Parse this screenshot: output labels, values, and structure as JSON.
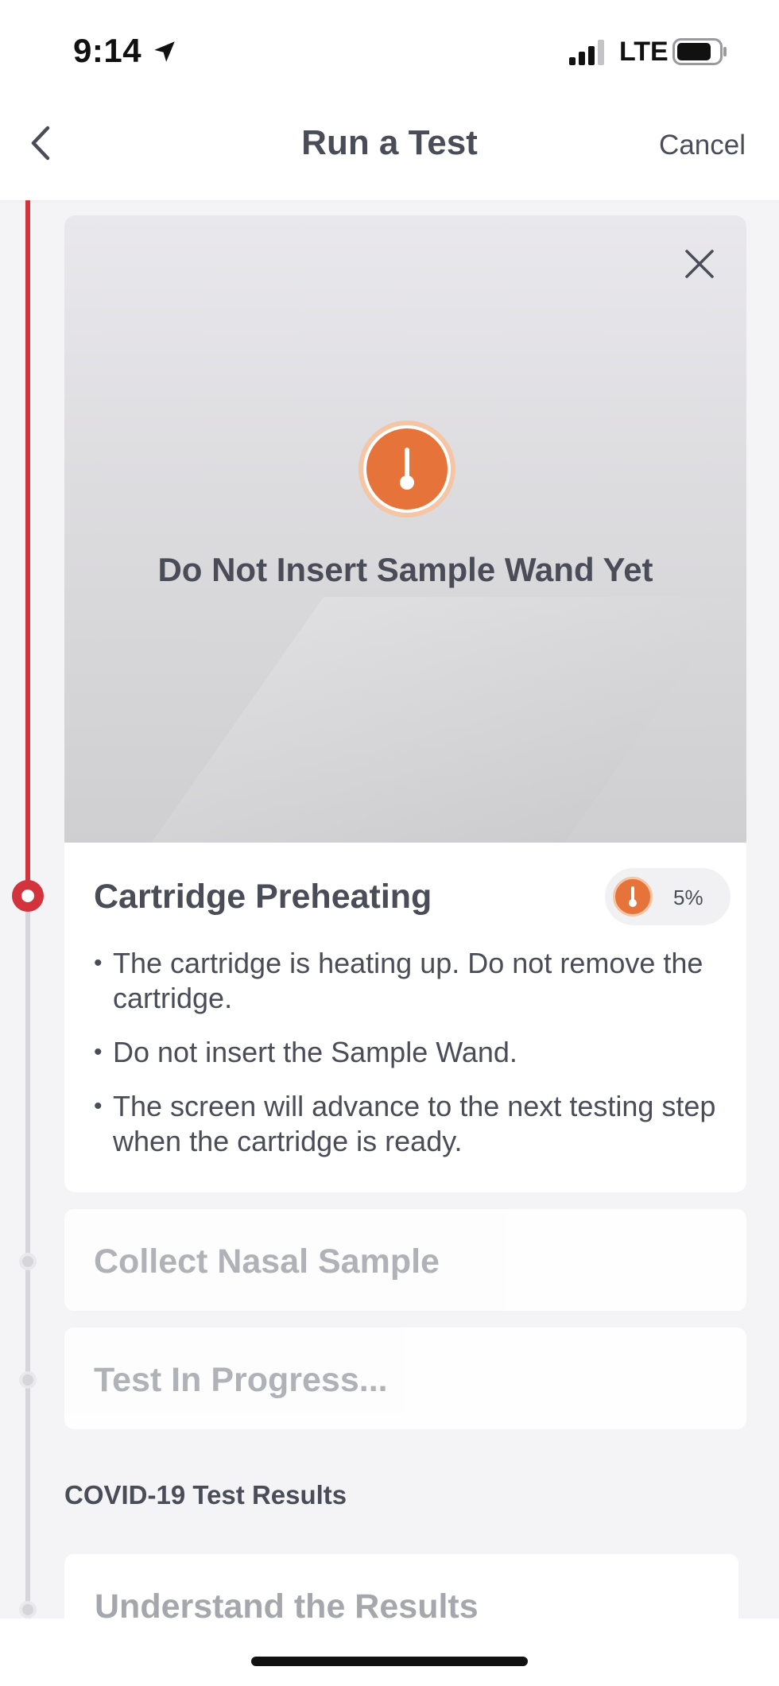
{
  "status_bar": {
    "time": "9:14",
    "network": "LTE",
    "icons": [
      "location-arrow-icon",
      "signal-bars-icon",
      "battery-icon"
    ]
  },
  "nav": {
    "title": "Run a Test",
    "cancel_label": "Cancel",
    "back_icon": "chevron-left-icon"
  },
  "hero": {
    "title": "Do Not Insert Sample Wand Yet",
    "close_icon": "close-icon",
    "alert_icon": "thermometer-alert-icon",
    "alert_color": "#e5733a"
  },
  "steps": {
    "active": {
      "title": "Cartridge Preheating",
      "progress_label": "5%",
      "progress_value": 0.05,
      "bullets": [
        "The cartridge is heating up. Do not remove the cartridge.",
        "Do not insert the Sample Wand.",
        "The screen will advance to the next testing step when the cartridge is ready."
      ]
    },
    "pending": [
      {
        "label": "Collect Nasal Sample"
      },
      {
        "label": "Test In Progress..."
      }
    ]
  },
  "results_section": {
    "heading": "COVID-19 Test Results",
    "items": [
      {
        "label": "Understand the Results"
      }
    ]
  },
  "colors": {
    "timeline_active": "#d2333d",
    "timeline_inactive": "#d6d6da",
    "accent_orange": "#e5733a",
    "text_primary": "#4a4d58",
    "text_muted": "#a6a7ad"
  }
}
